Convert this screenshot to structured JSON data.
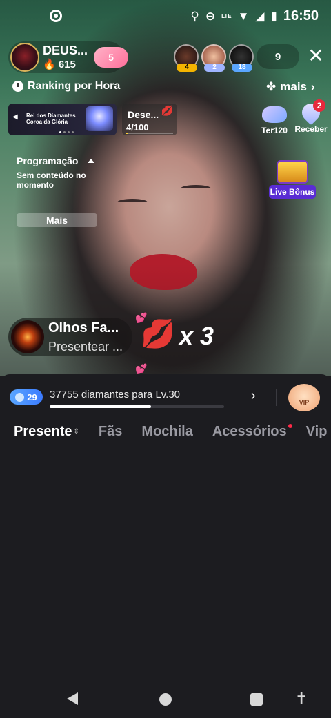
{
  "status_bar": {
    "time": "16:50",
    "network": "LTE"
  },
  "host": {
    "name": "DEUS...",
    "fans": "615",
    "heart_level": "5"
  },
  "viewers": [
    {
      "badge": "4",
      "badge_color": "#f4b400"
    },
    {
      "badge": "2",
      "badge_color": "#9fb4ff"
    },
    {
      "badge": "18",
      "badge_color": "#5aa6ff"
    }
  ],
  "viewer_count": "9",
  "ranking": {
    "label": "Ranking por Hora",
    "more_label": "mais"
  },
  "banner": {
    "line1": "Rei dos Diamantes",
    "line2": "Coroa da Glória"
  },
  "desejo": {
    "title": "Dese...",
    "progress": "4/100",
    "progress_value": 0.04
  },
  "right_icons": {
    "gem_label": "Ter120",
    "receive_label": "Receber",
    "receive_badge": "2"
  },
  "live_bonus": {
    "label": "Live Bônus"
  },
  "programacao": {
    "title": "Programação",
    "empty": "Sem conteúdo no momento",
    "more_button": "Mais"
  },
  "gift_message": {
    "user": "Olhos Fa...",
    "action": "Presentear ...",
    "count": "x 3"
  },
  "level": {
    "badge": "29",
    "text": "37755 diamantes para Lv.30",
    "progress": 0.58,
    "vip_label": "VIP"
  },
  "tabs": [
    {
      "label": "Presente",
      "active": true
    },
    {
      "label": "Fãs",
      "active": false
    },
    {
      "label": "Mochila",
      "active": false
    },
    {
      "label": "Acessórios",
      "active": false,
      "dot": true
    },
    {
      "label": "Vip",
      "active": false
    }
  ],
  "colors": {
    "panel_bg": "#1c1c20",
    "accent_blue": "#3b7bff",
    "live_bonus": "#5a2cd4",
    "red_dot": "#e8283c"
  }
}
